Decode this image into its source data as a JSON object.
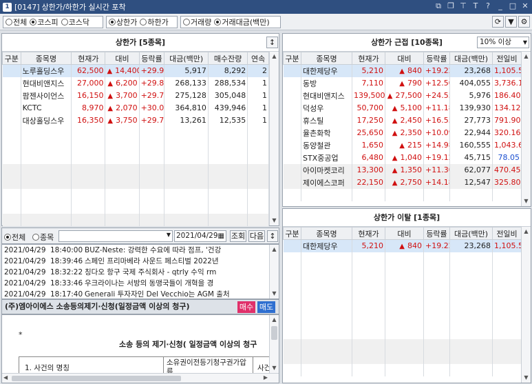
{
  "window": {
    "code": "[0147]",
    "title": "상한가/하한가 실시간 포착",
    "badge": "1"
  },
  "toolbar": {
    "market": [
      "전체",
      "코스피",
      "코스닥"
    ],
    "market_selected": 1,
    "limit": [
      "상한가",
      "하한가"
    ],
    "limit_selected": 0,
    "sort": [
      "거래량",
      "거래대금(백만)"
    ],
    "sort_selected": 1
  },
  "upper": {
    "title": "상한가 [5종목]",
    "columns": [
      "구분",
      "종목명",
      "현재가",
      "대비",
      "등락률",
      "대금(백만)",
      "매수잔량",
      "연속"
    ],
    "rows": [
      {
        "name": "노루홀딩스우",
        "price": "62,500",
        "diff": "14,400",
        "rate": "+29.94",
        "amount": "5,917",
        "bid": "8,292",
        "cont": "2"
      },
      {
        "name": "현대비앤지스",
        "price": "27,000",
        "diff": "6,200",
        "rate": "+29.81",
        "amount": "268,133",
        "bid": "288,534",
        "cont": "1"
      },
      {
        "name": "팜젠사이언스",
        "price": "16,150",
        "diff": "3,700",
        "rate": "+29.72",
        "amount": "275,128",
        "bid": "305,048",
        "cont": "1"
      },
      {
        "name": "KCTC",
        "price": "8,970",
        "diff": "2,070",
        "rate": "+30.00",
        "amount": "364,810",
        "bid": "439,946",
        "cont": "1"
      },
      {
        "name": "대상홀딩스우",
        "price": "16,350",
        "diff": "3,750",
        "rate": "+29.76",
        "amount": "13,261",
        "bid": "12,535",
        "cont": "1"
      }
    ]
  },
  "near": {
    "title": "상한가 근접 [10종목]",
    "filter": "10% 이상",
    "columns": [
      "구분",
      "종목명",
      "현재가",
      "대비",
      "등락률",
      "대금(백만)",
      "전일비"
    ],
    "rows": [
      {
        "name": "대한제당우",
        "price": "5,210",
        "diff": "840",
        "rate": "+19.22",
        "amount": "23,268",
        "prev": "1,105.52",
        "pc": "red"
      },
      {
        "name": "동방",
        "price": "7,110",
        "diff": "790",
        "rate": "+12.50",
        "amount": "404,055",
        "prev": "3,736.16",
        "pc": "red"
      },
      {
        "name": "현대비앤지스",
        "price": "139,500",
        "diff": "27,500",
        "rate": "+24.55",
        "amount": "5,976",
        "prev": "186.40",
        "pc": "red"
      },
      {
        "name": "덕성우",
        "price": "50,700",
        "diff": "5,100",
        "rate": "+11.18",
        "amount": "139,930",
        "prev": "134.12",
        "pc": "red"
      },
      {
        "name": "휴스틸",
        "price": "17,250",
        "diff": "2,450",
        "rate": "+16.55",
        "amount": "27,773",
        "prev": "791.90",
        "pc": "red"
      },
      {
        "name": "율촌화학",
        "price": "25,650",
        "diff": "2,350",
        "rate": "+10.09",
        "amount": "22,944",
        "prev": "320.16",
        "pc": "red"
      },
      {
        "name": "동양철관",
        "price": "1,650",
        "diff": "215",
        "rate": "+14.98",
        "amount": "160,555",
        "prev": "1,043.67",
        "pc": "red"
      },
      {
        "name": "STX중공업",
        "price": "6,480",
        "diff": "1,040",
        "rate": "+19.12",
        "amount": "45,715",
        "prev": "78.05",
        "pc": "blue"
      },
      {
        "name": "아이마켓코리",
        "price": "13,300",
        "diff": "1,350",
        "rate": "+11.30",
        "amount": "62,077",
        "prev": "470.45",
        "pc": "red"
      },
      {
        "name": "제이에스코퍼",
        "price": "22,150",
        "diff": "2,750",
        "rate": "+14.18",
        "amount": "12,547",
        "prev": "325.80",
        "pc": "red"
      }
    ]
  },
  "exit": {
    "title": "상한가 이탈 [1종목]",
    "columns": [
      "구분",
      "종목명",
      "현재가",
      "대비",
      "등락률",
      "대금(백만)",
      "전일비"
    ],
    "rows": [
      {
        "name": "대한제당우",
        "price": "5,210",
        "diff": "840",
        "rate": "+19.22",
        "amount": "23,268",
        "prev": "1,105.52"
      }
    ]
  },
  "news": {
    "filter": [
      "전체",
      "종목"
    ],
    "date": "2021/04/29",
    "query": "조회",
    "next": "다음",
    "items": [
      {
        "date": "2021/04/29",
        "time": "18:40:00",
        "text": "BUZ-Neste: 강력한 수요에 따라 점프, '건강"
      },
      {
        "date": "2021/04/29",
        "time": "18:39:46",
        "text": "스페인 프리마베라 사운드 페스티벌 2022년"
      },
      {
        "date": "2021/04/29",
        "time": "18:32:22",
        "text": "칭다오 항구 국제 주식회사 - qtrly 수익 rm"
      },
      {
        "date": "2021/04/29",
        "time": "18:33:46",
        "text": "우크라이나는 서방의 동맹국들이 개혁을 경"
      },
      {
        "date": "2021/04/29",
        "time": "18:17:40",
        "text": "Generali 투자자인 Del Vecchio는 AGM 출처"
      }
    ]
  },
  "doc": {
    "title": "(주)엠아이에스 소송등의제기·신청(일정금액 이상의 청구)",
    "buy": "매수",
    "sell": "매도",
    "star": "*",
    "heading": "소송 등의 제기·신청( 일정금액 이상의 청구",
    "cell1": "1. 사건의 명칭",
    "cell2": "소유권이전등기청구권가압류",
    "cell3": "사건"
  }
}
